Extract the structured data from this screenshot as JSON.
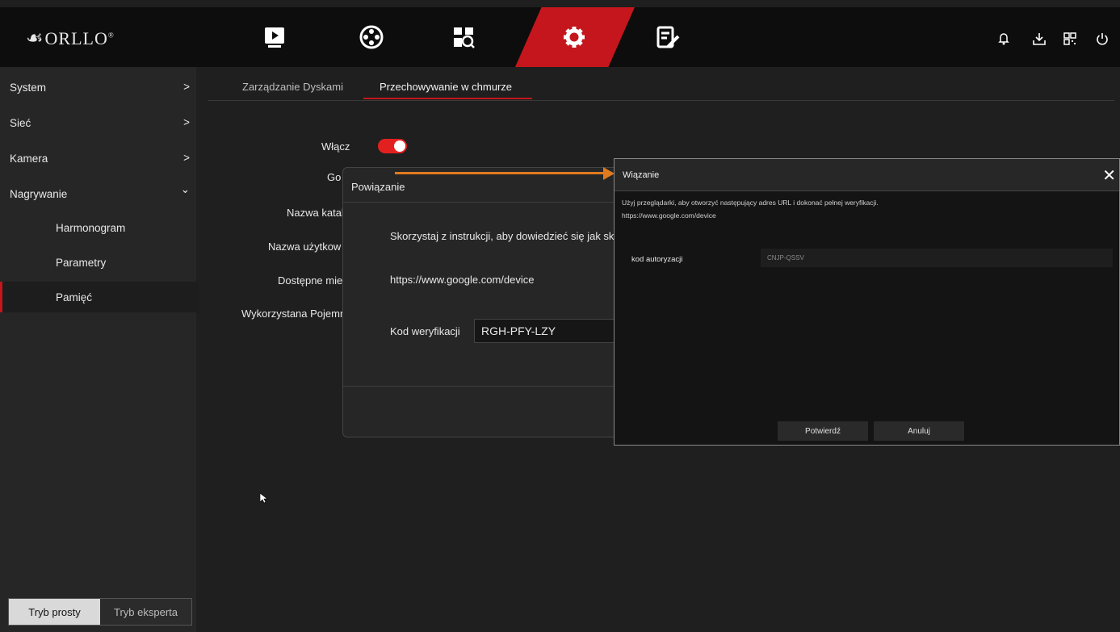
{
  "brand": {
    "name": "ORLLO",
    "mark": "☙",
    "registered": "®"
  },
  "topnav": {
    "items": [
      {
        "id": "playback",
        "icon": "play-icon"
      },
      {
        "id": "ai",
        "icon": "film-reel-icon"
      },
      {
        "id": "search",
        "icon": "search-icon"
      },
      {
        "id": "settings",
        "icon": "gear-icon",
        "active": true
      },
      {
        "id": "maintenance",
        "icon": "wrench-list-icon"
      }
    ],
    "right_icons": [
      "bell-icon",
      "download-icon",
      "qr-icon",
      "power-icon"
    ],
    "accent_color": "#c4161c"
  },
  "sidebar": {
    "items": [
      {
        "label": "System",
        "chevron": ">"
      },
      {
        "label": "Sieć",
        "chevron": ">"
      },
      {
        "label": "Kamera",
        "chevron": ">"
      },
      {
        "label": "Nagrywanie",
        "chevron": "⌄"
      }
    ],
    "subitems": [
      {
        "label": "Harmonogram"
      },
      {
        "label": "Parametry"
      },
      {
        "label": "Pamięć",
        "active": true
      }
    ],
    "mode": {
      "simple": "Tryb prosty",
      "expert": "Tryb eksperta",
      "selected": "simple"
    }
  },
  "tabs": [
    {
      "label": "Zarządzanie Dyskami"
    },
    {
      "label": "Przechowywanie w chmurze",
      "active": true
    }
  ],
  "form": {
    "enable_label": "Włącz",
    "enable_value": true,
    "labels": [
      "Go",
      "Nazwa katal",
      "Nazwa użytkow",
      "Dostępne mie",
      "Wykorzystana Pojemn"
    ]
  },
  "binding_dialog": {
    "title": "Powiązanie",
    "instruction": "Skorzystaj z instrukcji, aby dowiedzieć się jak sk",
    "url": "https://www.google.com/device",
    "code_label": "Kod weryfikacji",
    "code_value": "RGH-PFY-LZY"
  },
  "wiazanie_dialog": {
    "title": "Wiązanie",
    "close": "✕",
    "instruction": "Użyj przeglądarki, aby otworzyć następujący adres URL i dokonać pełnej weryfikacji.",
    "url": "https://www.google.com/device",
    "auth_label": "kod autoryzacji",
    "auth_value": "CNJP-QSSV",
    "confirm": "Potwierdź",
    "cancel": "Anuluj"
  },
  "annotation_color": "#e07a1f"
}
